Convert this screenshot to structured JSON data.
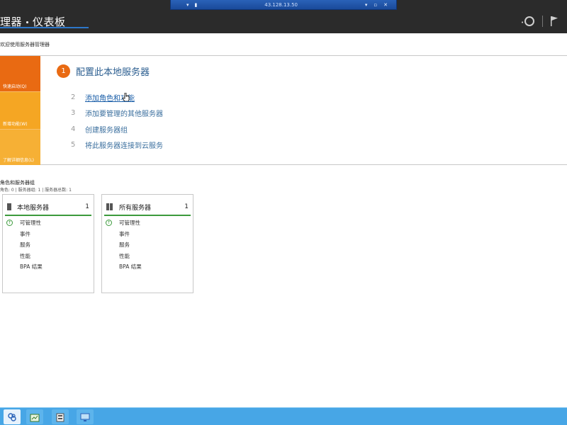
{
  "rdp_bar": {
    "ip": "43.128.13.50"
  },
  "header": {
    "breadcrumb_left": "理器",
    "breadcrumb_right": "仪表板"
  },
  "welcome": "欢迎使用服务器管理器",
  "quick_start": {
    "tabs": [
      "快速启动(Q)",
      "新增功能(W)",
      "了解详细信息(L)"
    ],
    "main_step": {
      "num": "1",
      "label": "配置此本地服务器"
    },
    "steps": [
      {
        "num": "2",
        "label": "添加角色和功能"
      },
      {
        "num": "3",
        "label": "添加要管理的其他服务器"
      },
      {
        "num": "4",
        "label": "创建服务器组"
      },
      {
        "num": "5",
        "label": "将此服务器连接到云服务"
      }
    ]
  },
  "roles": {
    "title": "角色和服务器组",
    "subtitle": "角色: 0 | 服务器组: 1 | 服务器总数: 1",
    "tiles": [
      {
        "name": "本地服务器",
        "count": "1",
        "items": [
          "可管理性",
          "事件",
          "服务",
          "性能",
          "BPA 结果"
        ]
      },
      {
        "name": "所有服务器",
        "count": "1",
        "items": [
          "可管理性",
          "事件",
          "服务",
          "性能",
          "BPA 结果"
        ]
      }
    ]
  },
  "colors": {
    "header_bg": "#2b2b2b",
    "accent_orange": "#e96a12",
    "link_blue": "#1a5ea8",
    "status_green": "#3c9a3c",
    "taskbar": "#47a6e6"
  },
  "icons": [
    "pin-icon",
    "refresh-icon",
    "flag-icon",
    "server-icon",
    "all-servers-icon",
    "check-icon",
    "start-icon",
    "task-icon",
    "tools-icon",
    "monitor-icon"
  ]
}
